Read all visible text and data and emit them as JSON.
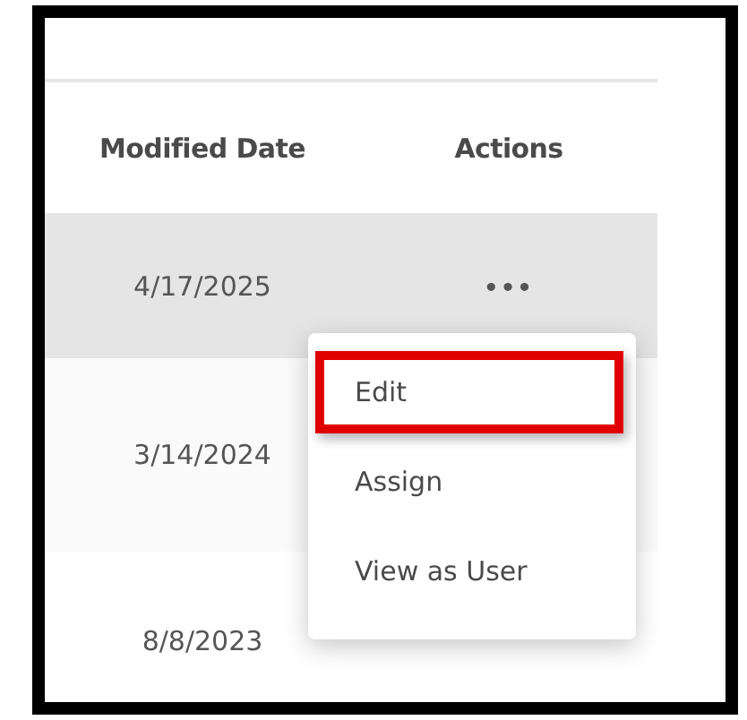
{
  "table": {
    "columns": [
      "Modified Date",
      "Actions"
    ],
    "rows": [
      {
        "modified_date": "4/17/2025",
        "actions": "•••",
        "highlighted": true
      },
      {
        "modified_date": "3/14/2024",
        "highlighted": false
      },
      {
        "modified_date": "8/8/2023",
        "highlighted": false
      }
    ]
  },
  "actions_menu": {
    "items": [
      {
        "label": "Edit",
        "highlighted": true
      },
      {
        "label": "Assign",
        "highlighted": false
      },
      {
        "label": "View as User",
        "highlighted": false
      }
    ]
  }
}
